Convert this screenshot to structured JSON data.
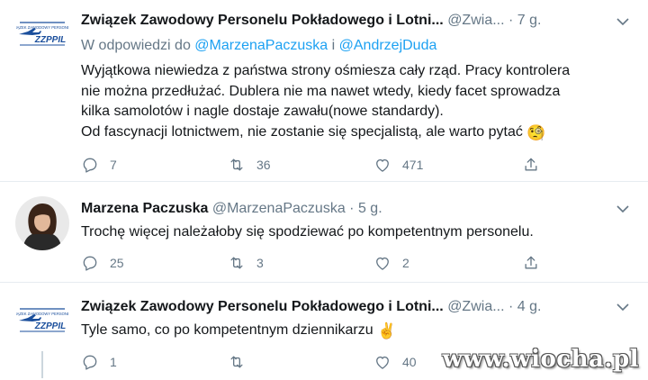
{
  "tweets": [
    {
      "author_name": "Związek Zawodowy Personelu Pokładowego i Lotni...",
      "handle": "@Zwia...",
      "separator": "·",
      "time": "7 g.",
      "avatar": "zzppil-logo",
      "reply_prefix": "W odpowiedzi do",
      "reply_user1": "@MarzenaPaczuska",
      "reply_conj": "i",
      "reply_user2": "@AndrzejDuda",
      "lines": [
        "Wyjątkowa niewiedza z państwa strony ośmiesza cały rząd. Pracy kontrolera",
        "nie można przedłużać. Dublera nie ma nawet wtedy, kiedy facet sprowadza",
        "kilka samolotów i nagle dostaje zawału(nowe standardy).",
        "Od fascynacji lotnictwem, nie zostanie się specjalistą, ale warto pytać"
      ],
      "emoji": "🧐",
      "replies": "7",
      "retweets": "36",
      "likes": "471"
    },
    {
      "author_name": "Marzena Paczuska",
      "handle": "@MarzenaPaczuska",
      "separator": "·",
      "time": "5 g.",
      "avatar": "user-photo",
      "text": "Trochę więcej należałoby się spodziewać po kompetentnym personelu.",
      "replies": "25",
      "retweets": "3",
      "likes": "2"
    },
    {
      "author_name": "Związek Zawodowy Personelu Pokładowego i Lotni...",
      "handle": "@Zwia...",
      "separator": "·",
      "time": "4 g.",
      "avatar": "zzppil-logo",
      "text": "Tyle samo, co po kompetentnym dziennikarzu",
      "emoji": "✌️",
      "replies": "1",
      "retweets": "",
      "likes": "40"
    }
  ],
  "logo_text": "ZZPPIL",
  "watermark": "www.wiocha.pl",
  "colors": {
    "link": "#1da1f2",
    "muted": "#657786",
    "text": "#14171a",
    "divider": "#e6ecf0",
    "logo": "#1b4f9c"
  },
  "icons": [
    "reply-icon",
    "retweet-icon",
    "like-icon",
    "share-icon",
    "caret-down-icon"
  ]
}
